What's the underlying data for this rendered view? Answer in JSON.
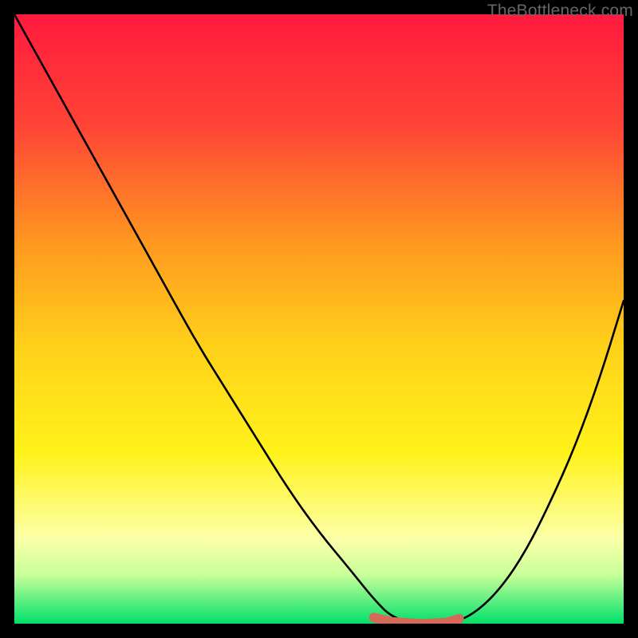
{
  "watermark": {
    "text": "TheBottleneck.com"
  },
  "chart_data": {
    "type": "line",
    "title": "",
    "xlabel": "",
    "ylabel": "",
    "xlim": [
      0,
      100
    ],
    "ylim": [
      0,
      100
    ],
    "grid": false,
    "legend": false,
    "gradient_stops": [
      {
        "offset": 0.0,
        "color": "#ff1a3e"
      },
      {
        "offset": 0.18,
        "color": "#ff4336"
      },
      {
        "offset": 0.38,
        "color": "#ff9a1f"
      },
      {
        "offset": 0.55,
        "color": "#ffd21a"
      },
      {
        "offset": 0.72,
        "color": "#fff21a"
      },
      {
        "offset": 0.86,
        "color": "#fcffa8"
      },
      {
        "offset": 0.92,
        "color": "#c8ff9a"
      },
      {
        "offset": 1.0,
        "color": "#00e06a"
      }
    ],
    "series": [
      {
        "name": "curve",
        "color": "#000000",
        "x": [
          0,
          5,
          10,
          15,
          20,
          25,
          30,
          35,
          40,
          45,
          50,
          55,
          59,
          62,
          66,
          68,
          72,
          76,
          80,
          84,
          88,
          92,
          96,
          100
        ],
        "y": [
          100,
          91,
          82,
          73,
          64,
          55,
          46,
          38,
          30,
          22,
          15,
          9,
          4,
          1,
          0,
          0,
          0,
          2,
          6,
          12,
          20,
          29,
          40,
          53
        ]
      },
      {
        "name": "highlight-band",
        "color": "#d56a5a",
        "x": [
          59,
          62,
          66,
          68,
          71,
          73
        ],
        "y": [
          1,
          0.3,
          0,
          0,
          0.2,
          0.8
        ]
      }
    ],
    "annotations": []
  }
}
